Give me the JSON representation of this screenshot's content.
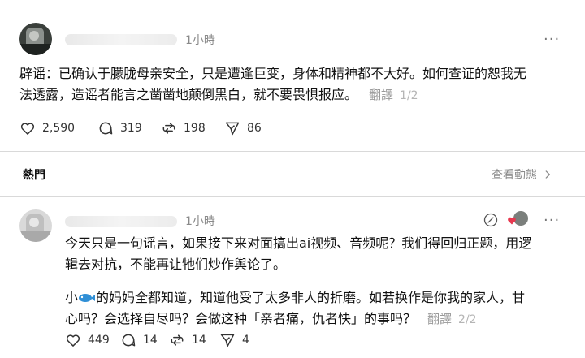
{
  "post": {
    "time": "1小時",
    "line1": "辟谣：已确认于朦胧母亲安全，只是遭逢巨变，身体和精神都不大好。如何查证的恕我无",
    "line2": "法透露，造谣者能言之凿凿地颠倒黑白，就不要畏惧报应。",
    "translate_label": "翻譯",
    "translate_count": "1/2",
    "likes": "2,590",
    "comments": "319",
    "reposts": "198",
    "shares": "86"
  },
  "section": {
    "hot_label": "熱門",
    "activity_label": "查看動態"
  },
  "reply": {
    "time": "1小時",
    "p1_line1": "今天只是一句谣言，如果接下来对面搞出ai视频、音频呢？我们得回归正题，用逻",
    "p1_line2": "辑去对抗，不能再让牠们炒作舆论了。",
    "p2_line1_before": "小",
    "p2_line1_after": "的妈妈全都知道，知道他受了太多非人的折磨。如若换作是你我的家人，甘",
    "p2_line2": "心吗？会选择自尽吗？会做这种「亲者痛，仇者快」的事吗？",
    "translate_label": "翻譯",
    "translate_count": "2/2",
    "likes": "449",
    "comments": "14",
    "reposts": "14",
    "shares": "4"
  },
  "icons": {
    "like": "heart-icon",
    "comment": "comment-bubble-icon",
    "repost": "repost-icon",
    "share": "send-icon",
    "more": "more-options-icon",
    "chevron": "chevron-right-icon",
    "edit": "edit-circle-icon",
    "fish": "fish-emoji-icon"
  },
  "colors": {
    "fish": "#2f8fd6",
    "heart_badge": "#e8384f"
  }
}
